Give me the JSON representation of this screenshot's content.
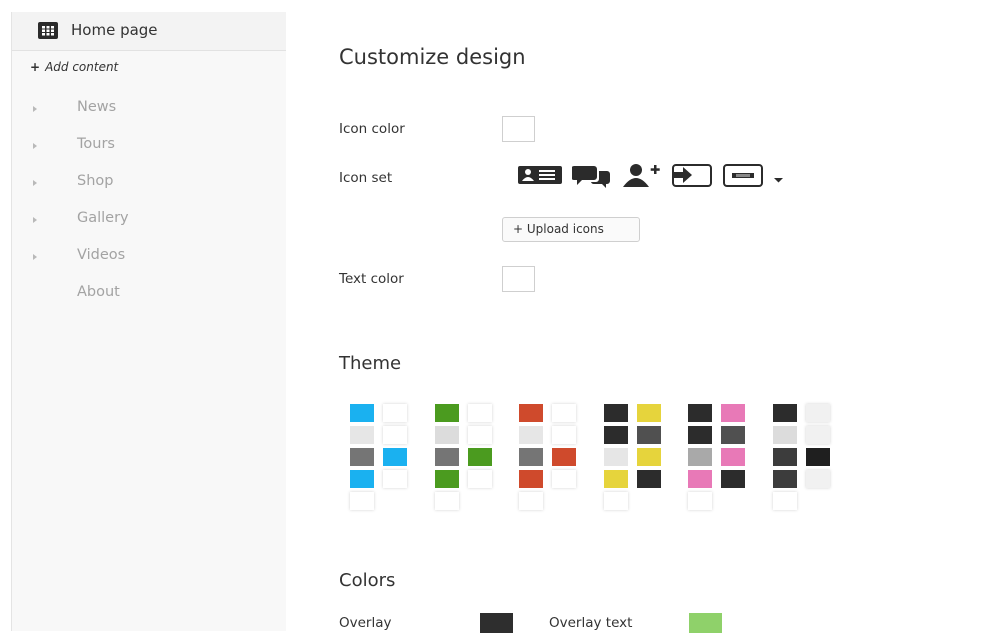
{
  "sidebar": {
    "home_label": "Home page",
    "add_content": "Add content",
    "add_symbol": "+",
    "items": [
      {
        "label": "News",
        "has_arrow": true
      },
      {
        "label": "Tours",
        "has_arrow": true
      },
      {
        "label": "Shop",
        "has_arrow": true
      },
      {
        "label": "Gallery",
        "has_arrow": true
      },
      {
        "label": "Videos",
        "has_arrow": true
      },
      {
        "label": "About",
        "has_arrow": false
      }
    ]
  },
  "main": {
    "title": "Customize design",
    "icon_color_label": "Icon color",
    "icon_set_label": "Icon set",
    "icon_set_icons": [
      "contact-card-icon",
      "chat-bubbles-icon",
      "add-user-icon",
      "sign-in-icon",
      "keyboard-icon",
      "dropdown-caret-icon"
    ],
    "upload_icons_label": "+ Upload icons",
    "text_color_label": "Text color",
    "theme_title": "Theme",
    "colors_title": "Colors",
    "overlay_label": "Overlay",
    "overlay_text_label": "Overlay text",
    "overlay_color": "#2e2e2e",
    "overlay_text_color": "#8fd16a"
  },
  "themes": [
    [
      "#1ab1f0",
      "#ffffff",
      "#e6e6e6",
      "#ffffff",
      "#757575",
      "#1ab1f0",
      "#1ab1f0",
      "#ffffff",
      "#ffffff"
    ],
    [
      "#4b9b1f",
      "#ffffff",
      "#dcdcdc",
      "#ffffff",
      "#757575",
      "#4b9b1f",
      "#4b9b1f",
      "#ffffff",
      "#ffffff"
    ],
    [
      "#cf4a2c",
      "#ffffff",
      "#e6e6e6",
      "#ffffff",
      "#757575",
      "#cf4a2c",
      "#cf4a2c",
      "#ffffff",
      "#ffffff"
    ],
    [
      "#2c2c2c",
      "#e6d43c",
      "#2c2c2c",
      "#505050",
      "#e6e6e6",
      "#e6d43c",
      "#e6d43c",
      "#2c2c2c",
      "#ffffff"
    ],
    [
      "#2c2c2c",
      "#e879b7",
      "#2c2c2c",
      "#505050",
      "#a9a9a9",
      "#e879b7",
      "#e879b7",
      "#2c2c2c",
      "#ffffff"
    ],
    [
      "#2c2c2c",
      "#f1f1f1",
      "#dcdcdc",
      "#f1f1f1",
      "#3c3c3c",
      "#1f1f1f",
      "#3c3c3c",
      "#f1f1f1",
      "#ffffff"
    ]
  ]
}
